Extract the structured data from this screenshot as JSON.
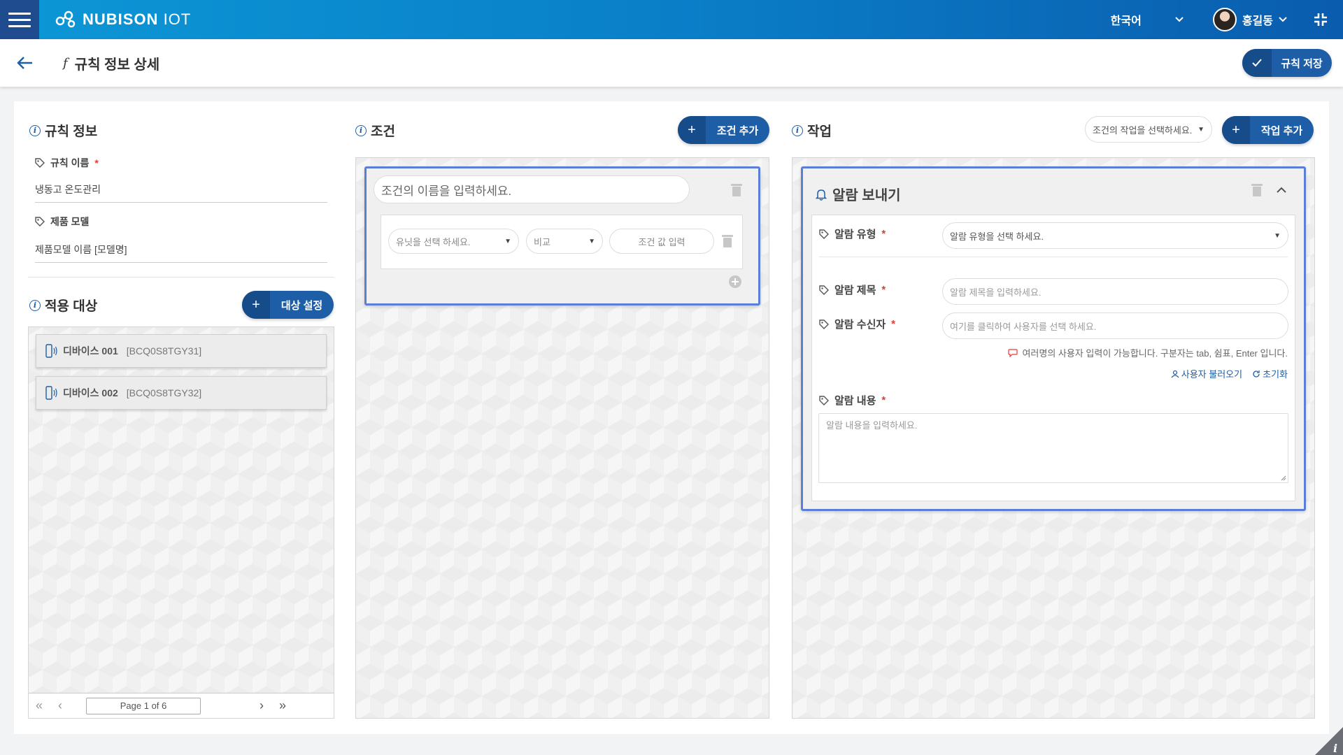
{
  "header": {
    "brand": "NUBISON",
    "brand_suffix": "IOT",
    "language": "한국어",
    "user_name": "홍길동"
  },
  "subheader": {
    "title": "규칙 정보 상세",
    "func_symbol": "f",
    "save_label": "규칙 저장"
  },
  "rule_info": {
    "title": "규칙 정보",
    "name_label": "규칙 이름",
    "name_value": "냉동고 온도관리",
    "model_label": "제품 모델",
    "model_value": "제품모델 이름 [모델명]"
  },
  "targets": {
    "title": "적용 대상",
    "set_button": "대상 설정",
    "devices": [
      {
        "name": "디바이스 001",
        "code": "[BCQ0S8TGY31]"
      },
      {
        "name": "디바이스 002",
        "code": "[BCQ0S8TGY32]"
      }
    ],
    "page_text": "Page 1 of 6"
  },
  "conditions": {
    "title": "조건",
    "add_button": "조건 추가",
    "name_placeholder": "조건의 이름을 입력하세요.",
    "unit_placeholder": "유닛을 선택 하세요.",
    "compare_label": "비교",
    "value_placeholder": "조건 값 입력"
  },
  "actions": {
    "title": "작업",
    "select_placeholder": "조건의 작업을 선택하세요.",
    "add_button": "작업 추가",
    "card_title": "알람 보내기",
    "type_label": "알람 유형",
    "type_placeholder": "알람 유형을 선택 하세요.",
    "subject_label": "알람 제목",
    "subject_placeholder": "알람 제목을 입력하세요.",
    "recipient_label": "알람 수신자",
    "recipient_placeholder": "여기를 클릭하여 사용자를 선택 하세요.",
    "recipient_hint": "여러명의 사용자 입력이 가능합니다. 구분자는 tab, 쉼표, Enter 입니다.",
    "load_users": "사용자 불러오기",
    "reset": "초기화",
    "content_label": "알람 내용",
    "content_placeholder": "알람 내용을 입력하세요."
  },
  "colors": {
    "primary": "#1d5ea6",
    "card_border": "#5b7fd6",
    "required": "#e53935"
  }
}
